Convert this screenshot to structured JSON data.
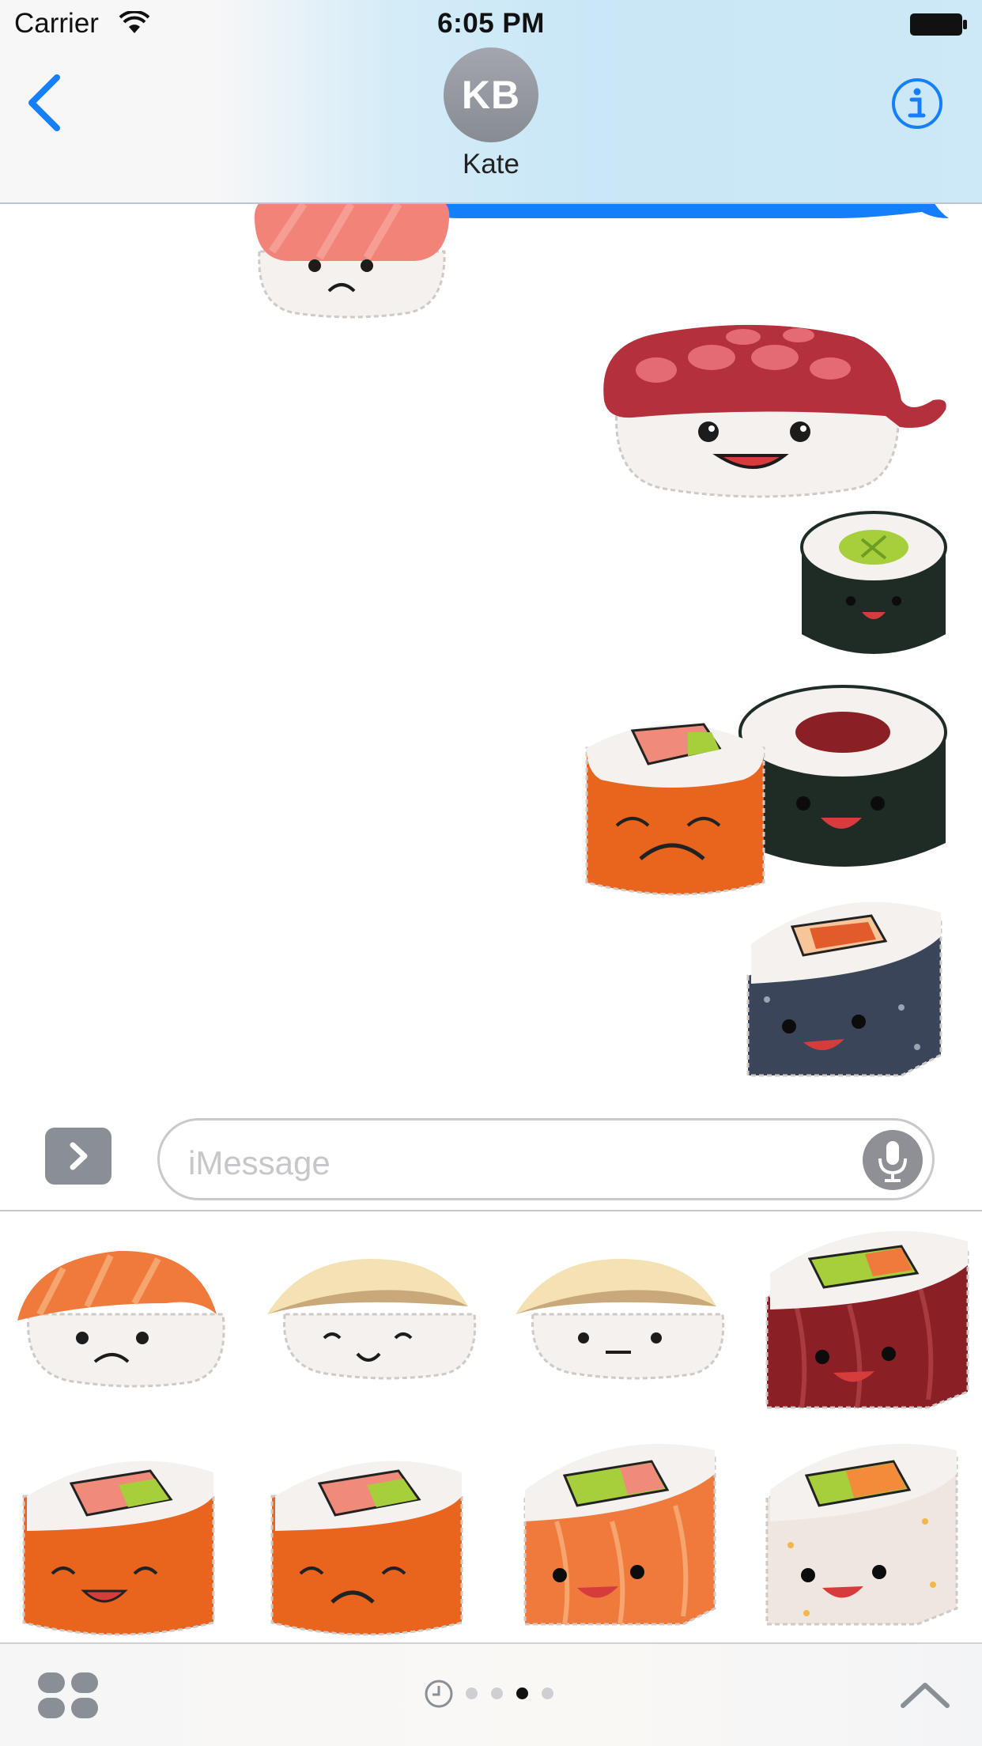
{
  "status_bar": {
    "carrier": "Carrier",
    "time": "6:05 PM"
  },
  "header": {
    "avatar_initials": "KB",
    "contact_name": "Kate"
  },
  "compose": {
    "placeholder": "iMessage"
  },
  "stickers_sent": [
    {
      "name": "sad-salmon-nigiri"
    },
    {
      "name": "happy-octopus-nigiri"
    },
    {
      "name": "cucumber-maki-roll"
    },
    {
      "name": "sad-tobiko-roll"
    },
    {
      "name": "tuna-maki-roll"
    },
    {
      "name": "black-sesame-roll"
    }
  ],
  "sticker_grid": [
    "salmon-nigiri-sad",
    "fish-nigiri-smile",
    "fish-nigiri-neutral",
    "tuna-roll-happy",
    "tobiko-roll-happy",
    "tobiko-roll-sad",
    "salmon-roll-happy",
    "sesame-roll-happy"
  ],
  "pagination": {
    "page_count": 4,
    "active_page": 3
  },
  "colors": {
    "ios_blue": "#147efb",
    "rice": "#f4f1ee",
    "salmon": "#f07a3c",
    "nori": "#1f2b25",
    "tobiko": "#e9651d",
    "tuna": "#8a1f25"
  }
}
